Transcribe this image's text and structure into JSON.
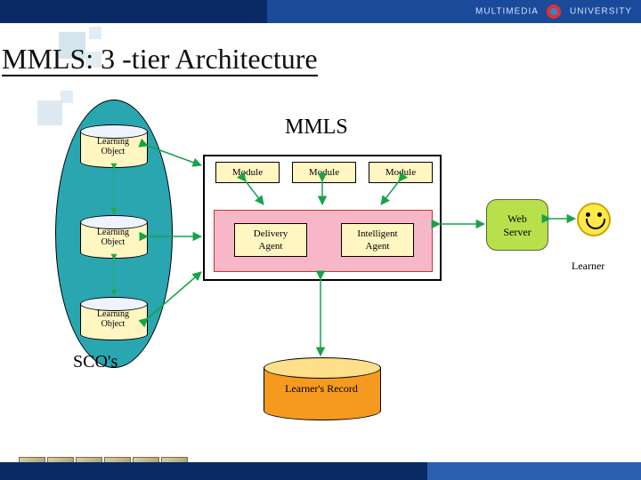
{
  "header": {
    "brand_left": "MULTIMEDIA",
    "brand_right": "UNIVERSITY"
  },
  "title": "MMLS: 3 -tier Architecture",
  "diagram": {
    "scos_label": "SCO's",
    "learning_objects": [
      {
        "label": "Learning\nObject"
      },
      {
        "label": "Learning\nObject"
      },
      {
        "label": "Learning\nObject"
      }
    ],
    "mmls_title": "MMLS",
    "modules": [
      "Module",
      "Module",
      "Module"
    ],
    "agents": [
      "Delivery\nAgent",
      "Intelligent\nAgent"
    ],
    "web_server": "Web\nServer",
    "learner_label": "Learner",
    "learner_record": "Learner's Record"
  }
}
